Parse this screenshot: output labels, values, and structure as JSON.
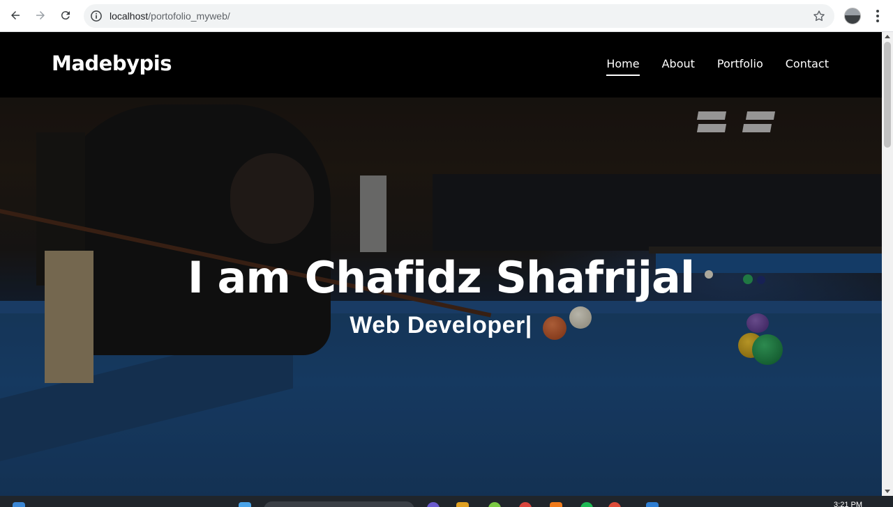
{
  "browser": {
    "url_host": "localhost",
    "url_path": "/portofolio_myweb/"
  },
  "site": {
    "logo": "Madebypis",
    "nav": [
      {
        "label": "Home",
        "active": true
      },
      {
        "label": "About",
        "active": false
      },
      {
        "label": "Portfolio",
        "active": false
      },
      {
        "label": "Contact",
        "active": false
      }
    ]
  },
  "hero": {
    "title": "I am Chafidz Shafrijal",
    "subtitle": "Web Developer|"
  },
  "taskbar": {
    "time": "3:21 PM"
  },
  "colors": {
    "header_bg": "#000000",
    "hero_text": "#ffffff",
    "table_felt": "#1d4f86"
  }
}
